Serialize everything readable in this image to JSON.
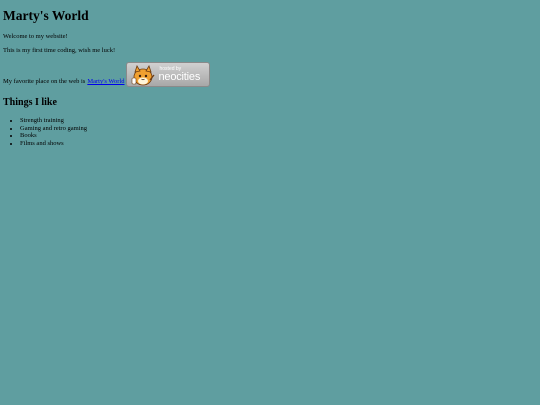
{
  "header": {
    "title": "Marty's World"
  },
  "intro": {
    "welcome": "Welcome to my website!",
    "first_time": "This is my first time coding, wish me luck!",
    "favorite_prefix": "My favorite place on the web is",
    "favorite_link": "Marty's World"
  },
  "badge": {
    "hosted_by": "hosted by",
    "brand": "neocities"
  },
  "likes": {
    "heading": "Things I like",
    "items": [
      "Strength training",
      "Gaming and retro gaming",
      "Books",
      "Films and shows"
    ]
  },
  "colors": {
    "background": "#5f9ea0",
    "link": "#0000ee"
  }
}
